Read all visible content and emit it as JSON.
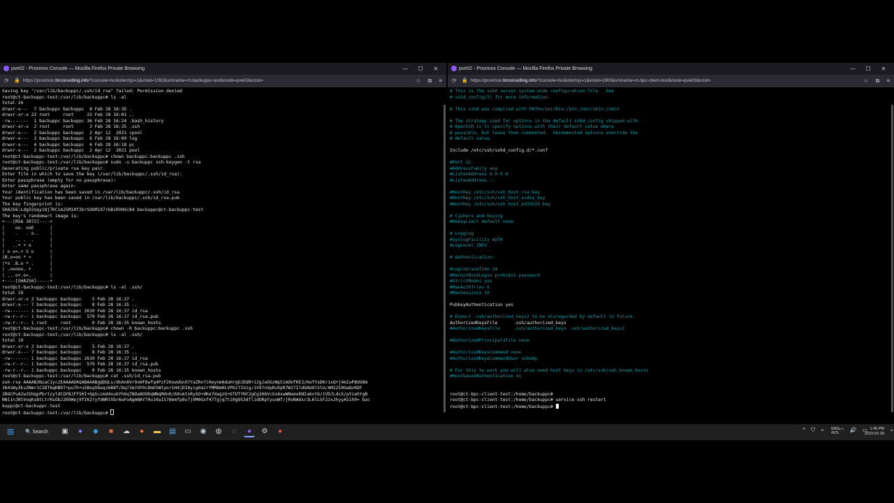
{
  "left_window": {
    "title": "pve02 - Proxmox Console — Mozilla Firefox Private Browsing",
    "url_prefix": "https://proxmox.",
    "url_domain": "brconsulting.info",
    "url_suffix": "/?console=lxc&xtermjs=1&vmid=1092&vmname=ct-backuppc-test&node=pve03&cmd=",
    "terminal_lines": [
      "Saving key \"/var/lib/backuppc/.ssh/id_rsa\" failed: Permission denied",
      "root@ct-backuppc-test:/var/lib/backuppc# ls -al",
      "total 24",
      "drwxr-x---  7 backuppc backuppc  8 Feb 28 16:35 .",
      "drwxr-xr-x 22 root     root     22 Feb 28 16:01 ..",
      "-rw-------  1 backuppc backuppc 36 Feb 28 16:24 .bash_history",
      "drwxr-xr-x  2 root     root      3 Feb 28 16:35 .ssh",
      "drwxr-x---  2 backuppc backuppc  2 Apr 12  2021 cpool",
      "drwxr-x---  2 backuppc backuppc  6 Feb 28 16:00 log",
      "drwxr-x---  4 backuppc backuppc  4 Feb 28 16:18 pc",
      "drwxr-x---  2 backuppc backuppc  2 Apr 12  2021 pool",
      "root@ct-backuppc-test:/var/lib/backuppc# chown backuppc:backuppc .ssh",
      "root@ct-backuppc-test:/var/lib/backuppc# sudo -u backuppc ssh-keygen -t rsa",
      "Generating public/private rsa key pair.",
      "Enter file in which to save the key (/var/lib/backuppc/.ssh/id_rsa):",
      "Enter passphrase (empty for no passphrase):",
      "Enter same passphrase again:",
      "Your identification has been saved in /var/lib/backuppc/.ssh/id_rsa",
      "Your public key has been saved in /var/lib/backuppc/.ssh/id_rsa.pub",
      "The key fingerprint is:",
      "SHA256:Ldg5SSqy1Qj7KC1m25M10f2krSOkM197rkBiRVHXcB4 backuppc@ct-backuppc-test",
      "The key's randomart image is:",
      "+---[RSA 3072]----+",
      "|    oo. ooE      |",
      "|    .   . o..    |",
      "|    .. .  .      |",
      "|   ..+ + o       |",
      "| o o=.+ S o      |",
      "|B.o=oo * =       |",
      "|*o .B.o * .      |",
      "| .ooooo. +       |",
      "| ...o+.o=.       |",
      "+----[SHA256]-----+",
      "root@ct-backuppc-test:/var/lib/backuppc# ls -al .ssh/",
      "total 19",
      "drwxr-xr-x 2 backuppc backuppc    5 Feb 28 16:37 .",
      "drwxr-x--- 7 backuppc backuppc    8 Feb 28 16:35 ..",
      "-rw------- 1 backuppc backuppc 2610 Feb 28 16:37 id_rsa",
      "-rw-r--r-- 1 backuppc backuppc  579 Feb 28 16:37 id_rsa.pub",
      "-rw-r--r-- 1 root     root        0 Feb 28 16:35 known_hosts",
      "root@ct-backuppc-test:/var/lib/backuppc# chown -R backuppc:backuppc .ssh",
      "root@ct-backuppc-test:/var/lib/backuppc# ls -al .ssh/",
      "total 19",
      "drwxr-xr-x 2 backuppc backuppc    5 Feb 28 16:37 .",
      "drwxr-x--- 7 backuppc backuppc    8 Feb 28 16:35 ..",
      "-rw------- 1 backuppc backuppc 2610 Feb 28 16:37 id_rsa",
      "-rw-r--r-- 1 backuppc backuppc  579 Feb 28 16:37 id_rsa.pub",
      "-rw-r--r-- 1 backuppc backuppc    0 Feb 28 16:35 known_hosts",
      "root@ct-backuppc-test:/var/lib/backuppc# cat .ssh/id_rsa.pub",
      "ssh-rsa AAAAB3NzaC1yc2EAAAADAQABAAABgQDQLs/dkAn8Vr9xWf6wfq4PzF20xwUGnX7YaZRn7i0eynmAduHrgOJDQR+12gJaGGzWp51AOUfKE3/KefYsDKr1xQ+j4mIwP8UU8m",
      "364sWyZkv2Nmr1CIBT6qKBbT+pu7h+u5BsqVbwqz6B8f/Dq73m7dY9cDmE5Wtyor1H4jDI8yigkmJrYMM8mHLVPDzTIUzg/1V97nVpRcKpR7W27IldOAUOl5lU/AM1259GwQvKDF",
      "2BOCPuA2w2SUqpPbrtzyldCOFBJFF5HI+QqSczmd4nukYh6q7NOa8OODqWNqMdnK/68vmtsRyXO+dKe7dagzG+OTUTYNY2gEg3O6VcGs6xwWNemxKNIa6xt6/1VDJLdcX/pYzahYgB",
      "NN11nJNtVoqKsBtLtrRsObJ269Wej9fIK2ryfdWRtXbr6wFoAgmNAY70u10aIS78emfp8v7j9M0Gxf47Tgjq7t10g953dTl1dURptysoWf/jRoNAUsr3L6lLSF22xJhyyA51h0= bac",
      "kuppc@ct-backuppc-test",
      "root@ct-backuppc-test:/var/lib/backuppc# "
    ]
  },
  "right_window": {
    "title": "pve02 - Proxmox Console — Mozilla Firefox Private Browsing",
    "url_prefix": "https://proxmox.",
    "url_domain": "brconsulting.info",
    "url_suffix": "/?console=lxc&xtermjs=1&vmid=1900&vmname=ct-bpc-client-test&node=pve03&cmd=",
    "terminal_lines": [
      {
        "text": "# This is the sshd server system-wide configuration file.  See",
        "comment": true
      },
      {
        "text": "# sshd_config(5) for more information.",
        "comment": true
      },
      {
        "text": "",
        "comment": false
      },
      {
        "text": "# This sshd was compiled with PATH=/usr/bin:/bin:/usr/sbin:/sbin",
        "comment": true
      },
      {
        "text": "",
        "comment": false
      },
      {
        "text": "# The strategy used for options in the default sshd_config shipped with",
        "comment": true
      },
      {
        "text": "# OpenSSH is to specify options with their default value where",
        "comment": true
      },
      {
        "text": "# possible, but leave them commented.  Uncommented options override the",
        "comment": true
      },
      {
        "text": "# default value.",
        "comment": true
      },
      {
        "text": "",
        "comment": false
      },
      {
        "text": "Include /etc/ssh/sshd_config.d/*.conf",
        "comment": false
      },
      {
        "text": "",
        "comment": false
      },
      {
        "text": "#Port 22",
        "comment": true
      },
      {
        "text": "#AddressFamily any",
        "comment": true
      },
      {
        "text": "#ListenAddress 0.0.0.0",
        "comment": true
      },
      {
        "text": "#ListenAddress ::",
        "comment": true
      },
      {
        "text": "",
        "comment": false
      },
      {
        "text": "#HostKey /etc/ssh/ssh_host_rsa_key",
        "comment": true
      },
      {
        "text": "#HostKey /etc/ssh/ssh_host_ecdsa_key",
        "comment": true
      },
      {
        "text": "#HostKey /etc/ssh/ssh_host_ed25519_key",
        "comment": true
      },
      {
        "text": "",
        "comment": false
      },
      {
        "text": "# Ciphers and keying",
        "comment": true
      },
      {
        "text": "#RekeyLimit default none",
        "comment": true
      },
      {
        "text": "",
        "comment": false
      },
      {
        "text": "# Logging",
        "comment": true
      },
      {
        "text": "#SyslogFacility AUTH",
        "comment": true
      },
      {
        "text": "#LogLevel INFO",
        "comment": true
      },
      {
        "text": "",
        "comment": false
      },
      {
        "text": "# Authentication:",
        "comment": true
      },
      {
        "text": "",
        "comment": false
      },
      {
        "text": "#LoginGraceTime 2m",
        "comment": true
      },
      {
        "text": "#PermitRootLogin prohibit-password",
        "comment": true
      },
      {
        "text": "#StrictModes yes",
        "comment": true
      },
      {
        "text": "#MaxAuthTries 6",
        "comment": true
      },
      {
        "text": "#MaxSessions 10",
        "comment": true
      },
      {
        "text": "",
        "comment": false
      },
      {
        "text": "PubkeyAuthentication yes",
        "comment": false
      },
      {
        "text": "",
        "comment": false
      },
      {
        "text": "# Expect .ssh/authorized_keys2 to be disregarded by default in future.",
        "comment": true
      },
      {
        "text": "AuthorizedKeysFile      .ssh/authorized_keys",
        "comment": false
      },
      {
        "text": "#AuthorizedKeysFile     .ssh/authorized_keys .ssh/authorized_keys2",
        "comment": true
      },
      {
        "text": "",
        "comment": false
      },
      {
        "text": "#AuthorizedPrincipalsFile none",
        "comment": true
      },
      {
        "text": "",
        "comment": false
      },
      {
        "text": "#AuthorizedKeysCommand none",
        "comment": true
      },
      {
        "text": "#AuthorizedKeysCommandUser nobody",
        "comment": true
      },
      {
        "text": "",
        "comment": false
      },
      {
        "text": "# For this to work you will also need host keys in /etc/ssh/ssh_known_hosts",
        "comment": true
      },
      {
        "text": "#HostbasedAuthentication no",
        "comment": true
      },
      {
        "text": "",
        "comment": false
      },
      {
        "text": "",
        "comment": false
      },
      {
        "text": "root@ct-bpc-client-test:/home/backuppc#",
        "comment": false
      },
      {
        "text": "root@ct-bpc-client-test:/home/backuppc# service ssh restart",
        "comment": false
      },
      {
        "text": "root@ct-bpc-client-test:/home/backuppc# ",
        "comment": false
      }
    ]
  },
  "taskbar": {
    "search_label": "Search",
    "lang_top": "ENG",
    "lang_bottom": "INTL",
    "time": "1:46 PM",
    "date": "2023-02-28",
    "apps": [
      {
        "name": "task-view-icon",
        "glyph": "▣",
        "color": "#cfcfcf"
      },
      {
        "name": "chat-icon",
        "glyph": "●",
        "color": "#7b83eb"
      },
      {
        "name": "vscode-icon",
        "glyph": "◆",
        "color": "#3c99dc"
      },
      {
        "name": "app-icon",
        "glyph": "■",
        "color": "#e06c3c"
      },
      {
        "name": "onedrive-icon",
        "glyph": "☁",
        "color": "#cfcfcf"
      },
      {
        "name": "firefox-icon",
        "glyph": "●",
        "color": "#ff7139"
      },
      {
        "name": "file-explorer-icon",
        "glyph": "▬",
        "color": "#f2c94c"
      },
      {
        "name": "notepad-icon",
        "glyph": "▤",
        "color": "#5ab3f0"
      },
      {
        "name": "terminal-icon",
        "glyph": "▭",
        "color": "#cfcfcf"
      },
      {
        "name": "steam-icon",
        "glyph": "◉",
        "color": "#c7d5e0"
      },
      {
        "name": "chrome-icon",
        "glyph": "◍",
        "color": "#cfcfcf"
      },
      {
        "name": "app-icon-2",
        "glyph": "◌",
        "color": "#9bb4ff"
      },
      {
        "name": "firefox-private-icon",
        "glyph": "●",
        "color": "#9059ff"
      },
      {
        "name": "settings-icon",
        "glyph": "⚙",
        "color": "#cfcfcf"
      },
      {
        "name": "app-icon-3",
        "glyph": "●",
        "color": "#e5533d"
      }
    ]
  }
}
